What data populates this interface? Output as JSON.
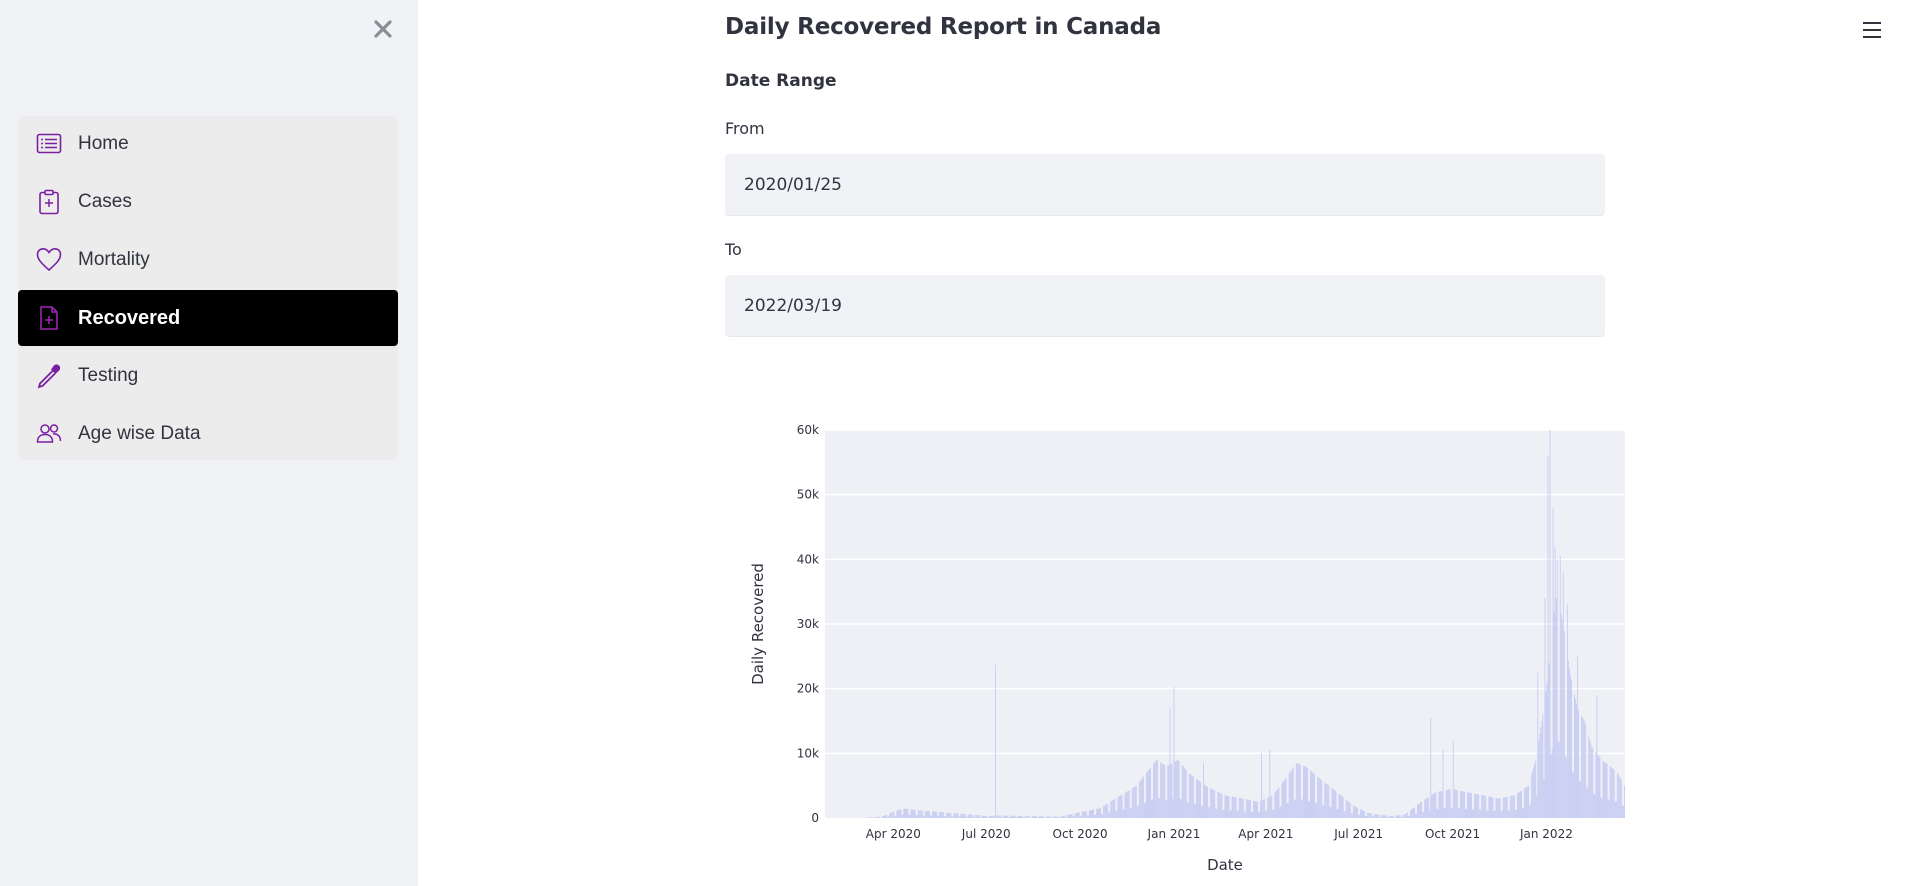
{
  "sidebar": {
    "items": [
      {
        "label": "Home",
        "icon": "list-icon"
      },
      {
        "label": "Cases",
        "icon": "clipboard-plus-icon"
      },
      {
        "label": "Mortality",
        "icon": "heart-icon"
      },
      {
        "label": "Recovered",
        "icon": "file-plus-icon",
        "active": true
      },
      {
        "label": "Testing",
        "icon": "eyedropper-icon"
      },
      {
        "label": "Age wise Data",
        "icon": "people-icon"
      }
    ],
    "accent_color": "#7b1fa2"
  },
  "header": {
    "title": "Daily Recovered Report in Canada"
  },
  "date_range": {
    "title": "Date Range",
    "from_label": "From",
    "from_value": "2020/01/25",
    "to_label": "To",
    "to_value": "2022/03/19"
  },
  "chart_data": {
    "type": "bar",
    "xlabel": "Date",
    "ylabel": "Daily Recovered",
    "ylim": [
      0,
      60000
    ],
    "y_ticks": [
      0,
      10000,
      20000,
      30000,
      40000,
      50000,
      60000
    ],
    "y_tick_labels": [
      "0",
      "10k",
      "20k",
      "30k",
      "40k",
      "50k",
      "60k"
    ],
    "x_tick_labels": [
      "Apr 2020",
      "Jul 2020",
      "Oct 2020",
      "Jan 2021",
      "Apr 2021",
      "Jul 2021",
      "Oct 2021",
      "Jan 2022"
    ],
    "x_tick_dates": [
      "2020-04-01",
      "2020-07-01",
      "2020-10-01",
      "2021-01-01",
      "2021-04-01",
      "2021-07-01",
      "2021-10-01",
      "2022-01-01"
    ],
    "xlim": [
      "2020-01-25",
      "2022-03-19"
    ],
    "bar_color": "#c5cbf2",
    "grid": true,
    "series": [
      {
        "x": [
          "2020-01-25",
          "2020-03-01",
          "2020-03-20",
          "2020-04-10",
          "2020-04-25",
          "2020-05-10",
          "2020-06-01",
          "2020-06-20",
          "2020-07-01",
          "2020-07-15",
          "2020-08-15",
          "2020-09-10",
          "2020-10-01",
          "2020-10-20",
          "2020-11-10",
          "2020-11-25",
          "2020-12-05",
          "2020-12-15",
          "2020-12-25",
          "2021-01-05",
          "2021-01-15",
          "2021-02-01",
          "2021-02-20",
          "2021-03-10",
          "2021-03-25",
          "2021-04-08",
          "2021-04-20",
          "2021-05-01",
          "2021-05-10",
          "2021-05-25",
          "2021-06-10",
          "2021-06-25",
          "2021-07-10",
          "2021-08-01",
          "2021-08-15",
          "2021-09-01",
          "2021-09-15",
          "2021-10-01",
          "2021-10-15",
          "2021-11-01",
          "2021-11-15",
          "2021-12-01",
          "2021-12-15",
          "2021-12-22",
          "2021-12-28",
          "2022-01-03",
          "2022-01-07",
          "2022-01-12",
          "2022-01-18",
          "2022-01-25",
          "2022-02-01",
          "2022-02-08",
          "2022-02-15",
          "2022-02-25",
          "2022-03-05",
          "2022-03-12",
          "2022-03-19"
        ],
        "values": [
          0,
          0,
          200,
          1500,
          1200,
          1000,
          700,
          500,
          300,
          400,
          300,
          200,
          900,
          1500,
          3500,
          5000,
          7000,
          9000,
          8000,
          9000,
          7000,
          5000,
          3500,
          3000,
          2500,
          3500,
          6000,
          8500,
          8000,
          6000,
          4000,
          2000,
          800,
          300,
          500,
          2500,
          4000,
          4500,
          4000,
          3500,
          3000,
          3500,
          5000,
          9000,
          15000,
          22000,
          30000,
          35000,
          30000,
          22000,
          17000,
          15000,
          11000,
          9000,
          8000,
          7000,
          5000
        ]
      }
    ],
    "spikes": [
      {
        "x": "2020-07-10",
        "value": 23700
      },
      {
        "x": "2020-12-28",
        "value": 17000
      },
      {
        "x": "2021-01-01",
        "value": 20300
      },
      {
        "x": "2021-01-30",
        "value": 8500
      },
      {
        "x": "2021-03-28",
        "value": 10000
      },
      {
        "x": "2021-04-05",
        "value": 10500
      },
      {
        "x": "2021-09-10",
        "value": 15500
      },
      {
        "x": "2021-09-22",
        "value": 10500
      },
      {
        "x": "2021-10-02",
        "value": 12000
      },
      {
        "x": "2021-12-24",
        "value": 22500
      },
      {
        "x": "2021-12-31",
        "value": 34000
      },
      {
        "x": "2022-01-03",
        "value": 56000
      },
      {
        "x": "2022-01-05",
        "value": 60000
      },
      {
        "x": "2022-01-08",
        "value": 48000
      },
      {
        "x": "2022-01-10",
        "value": 42000
      },
      {
        "x": "2022-01-12",
        "value": 40000
      },
      {
        "x": "2022-01-15",
        "value": 40500
      },
      {
        "x": "2022-01-18",
        "value": 38000
      },
      {
        "x": "2022-01-22",
        "value": 33000
      },
      {
        "x": "2022-02-01",
        "value": 25000
      },
      {
        "x": "2022-02-20",
        "value": 19000
      }
    ]
  }
}
